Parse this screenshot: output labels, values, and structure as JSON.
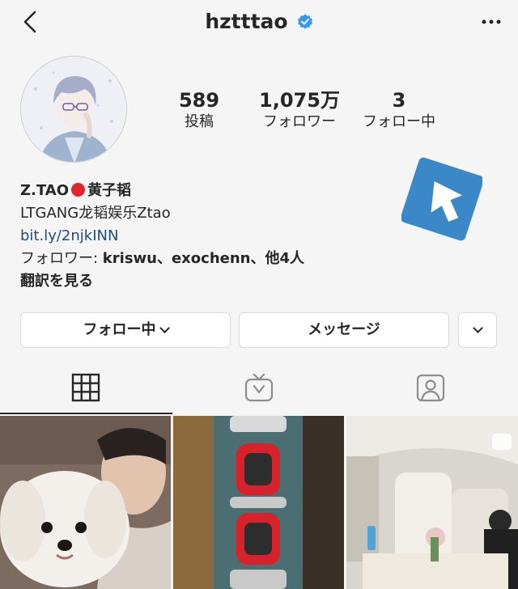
{
  "header": {
    "username": "hztttao",
    "back_icon": "chevron-left-icon",
    "verified_icon": "verified-badge-icon",
    "more_icon": "more-horizontal-icon"
  },
  "stats": {
    "posts_count": "589",
    "posts_label": "投稿",
    "followers_count": "1,075万",
    "followers_label": "フォロワー",
    "following_count": "3",
    "following_label": "フォロー中"
  },
  "bio": {
    "name_prefix": "Z.TAO",
    "name_suffix": "黄子韬",
    "line1": "LTGANG龙韬娱乐Ztao",
    "link": "bit.ly/2njkINN",
    "followed_by_prefix": "フォロワー: ",
    "followed_by_users": "kriswu、exochenn、他4人",
    "translate": "翻訳を見る"
  },
  "actions": {
    "follow_label": "フォロー中",
    "message_label": "メッセージ"
  },
  "tabs": [
    "grid-icon",
    "igtv-icon",
    "tagged-icon"
  ],
  "posts": [
    {
      "subject": "selfie-with-white-dog"
    },
    {
      "subject": "red-watches-display"
    },
    {
      "subject": "private-jet-interior"
    }
  ],
  "colors": {
    "background": "#f5f5f5",
    "verified_blue": "#3897f0",
    "link_blue": "#1e4d80",
    "red_dot": "#e0252b",
    "arrow_badge_blue": "#3b88c8"
  }
}
